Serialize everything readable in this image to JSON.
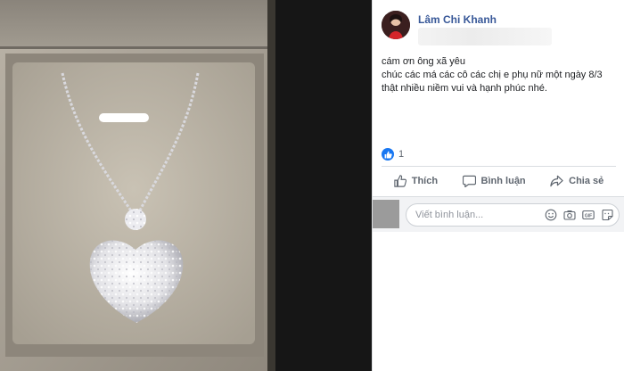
{
  "post": {
    "author_name": "Lâm Chi Khanh",
    "text_lines": [
      "cám ơn ông xã yêu",
      "chúc các má các cô các chị e phụ nữ một ngày 8/3",
      "thật nhiều niềm vui và hạnh phúc nhé."
    ],
    "reaction_count": "1",
    "reaction_icon": "like-icon"
  },
  "actions": {
    "like_label": "Thích",
    "comment_label": "Bình luận",
    "share_label": "Chia sẻ"
  },
  "comment": {
    "placeholder": "Viết bình luận...",
    "icons": [
      "emoji-icon",
      "camera-icon",
      "gif-icon",
      "sticker-icon"
    ]
  },
  "colors": {
    "author": "#385898",
    "like_blue": "#1877f2",
    "action_text": "#606770"
  }
}
